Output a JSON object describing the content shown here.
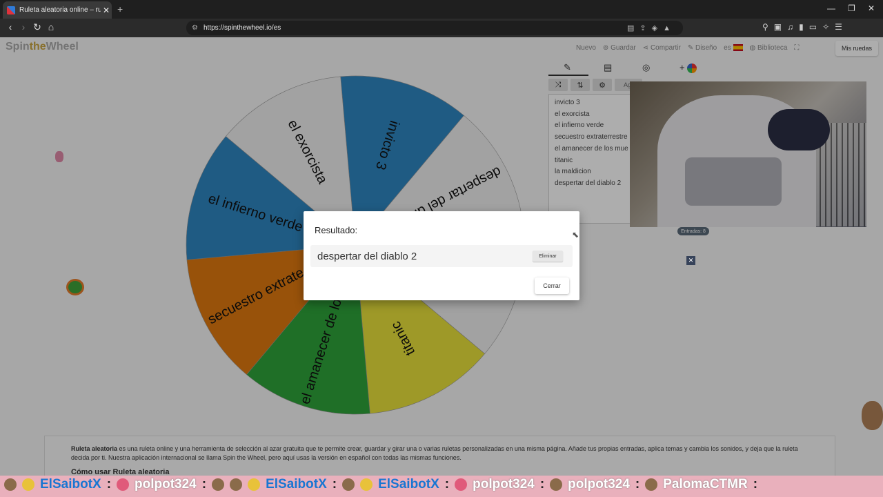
{
  "browser": {
    "tab_title": "Ruleta aleatoria online – ruleta d",
    "tab_close": "✕",
    "new_tab": "+",
    "url": "https://spinthewheel.io/es",
    "window_controls": [
      "—",
      "❐",
      "✕"
    ]
  },
  "site": {
    "logo_left": "Spin",
    "logo_accent": "the",
    "logo_right": "Wheel",
    "nav": {
      "nuevo": "Nuevo",
      "guardar": "Guardar",
      "compartir": "Compartir",
      "diseno": "Diseño",
      "lang": "es",
      "biblioteca": "Biblioteca"
    },
    "mis_ruedas": "Mis ruedas"
  },
  "wheel": {
    "segments": [
      {
        "label": "invicto 3",
        "color": "#2f86c2"
      },
      {
        "label": "despertar del dia…",
        "color": "#efefef"
      },
      {
        "label": "la maldicion",
        "color": "#efefef"
      },
      {
        "label": "titanic",
        "color": "#e9e23b"
      },
      {
        "label": "el amanecer de lo…",
        "color": "#2fa43a"
      },
      {
        "label": "secuestro extrate…",
        "color": "#e07a10"
      },
      {
        "label": "el infierno verde",
        "color": "#2f86c2"
      },
      {
        "label": "el exorcista",
        "color": "#efefef"
      }
    ]
  },
  "panel": {
    "tab_add_color": "+",
    "tool_add": "Agr",
    "entries": [
      "invicto 3",
      "el exorcista",
      "el infierno verde",
      "secuestro extraterrestre",
      "el amanecer de los mue",
      "titanic",
      "la maldicion",
      "despertar del diablo 2"
    ],
    "entries_count": "Entradas: 8"
  },
  "description": {
    "bold": "Ruleta aleatoria",
    "text": " es una ruleta online y una herramienta de selección al azar gratuita que te permite crear, guardar y girar una o varias ruletas personalizadas en una misma página. Añade tus propias entradas, aplica temas y cambia los sonidos, y deja que la ruleta decida por ti. Nuestra aplicación internacional se llama Spin the Wheel, pero aquí usas la versión en español con todas las mismas funciones.",
    "subheading": "Cómo usar Ruleta aleatoria"
  },
  "dialog": {
    "title": "Resultado:",
    "result": "despertar del diablo 2",
    "remove_label": "Eliminar",
    "close_label": "Cerrar"
  },
  "chat": {
    "users": [
      "ElSaibotX",
      "polpot324",
      "ElSaibotX",
      "ElSaibotX",
      "polpot324",
      "polpot324",
      "PalomaCTMR"
    ]
  }
}
